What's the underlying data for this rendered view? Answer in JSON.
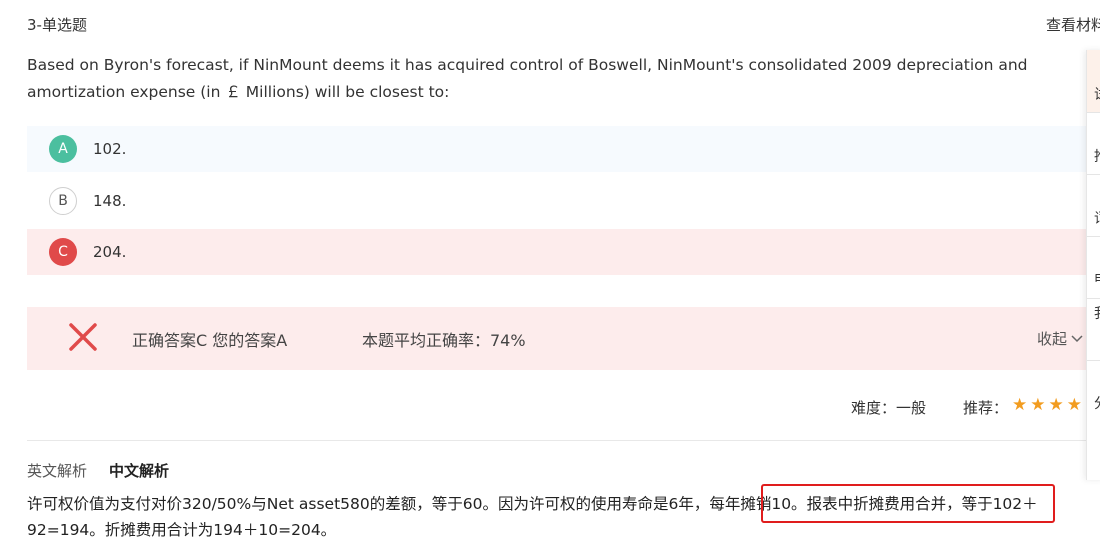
{
  "header": {
    "question_type": "3-单选题",
    "view_material": "查看材料"
  },
  "question": {
    "text": "Based on Byron's forecast, if NinMount deems it has acquired control of Boswell, NinMount's consolidated 2009 depreciation and amortization expense (in ￡ Millions) will be closest to:"
  },
  "options": [
    {
      "letter": "A",
      "text": "102.",
      "state": "selected"
    },
    {
      "letter": "B",
      "text": "148.",
      "state": "normal"
    },
    {
      "letter": "C",
      "text": "204.",
      "state": "correct"
    }
  ],
  "result": {
    "icon": "wrong-x-icon",
    "answer_text": "正确答案C 您的答案A",
    "rate_text": "本题平均正确率：74%",
    "collapse_label": "收起"
  },
  "meta": {
    "difficulty": "难度：一般",
    "recommend_label": "推荐：",
    "stars": 4
  },
  "tabs": {
    "english": "英文解析",
    "chinese": "中文解析"
  },
  "analysis": {
    "part1": "许可权价值为支付对价320/50%与Net asset580的差额，等于60。因为许可权的使用寿命是6年，每年摊销10。",
    "part2": "报表中折摊费用合并，等于102＋92=194。",
    "part3": "折摊费用合计为194＋10=204。"
  },
  "side_panel": {
    "items": [
      "试",
      "推",
      "词",
      "申",
      "我",
      "分"
    ]
  },
  "colors": {
    "correct_green": "#4bbf9f",
    "wrong_red": "#e04a4a",
    "result_bg": "#fdecec",
    "star": "#f29c1f",
    "highlight_border": "#e01d1d"
  }
}
